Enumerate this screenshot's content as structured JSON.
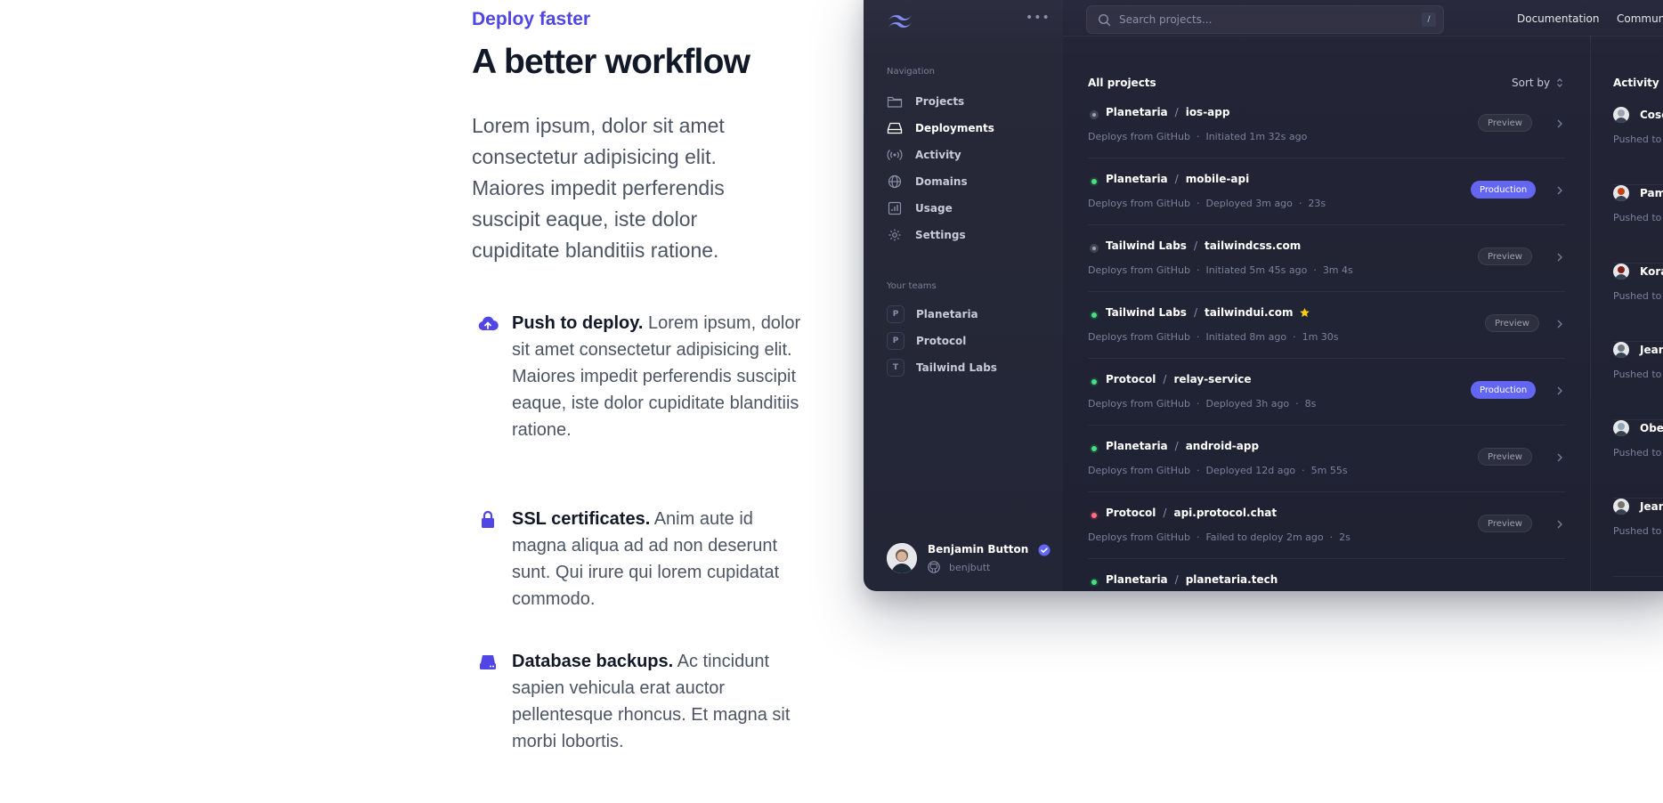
{
  "marketing": {
    "eyebrow": "Deploy faster",
    "headline": "A better workflow",
    "lead": "Lorem ipsum, dolor sit amet consectetur adipisicing elit. Maiores impedit perferendis suscipit eaque, iste dolor cupiditate blanditiis ratione.",
    "features": [
      {
        "title": "Push to deploy.",
        "text": " Lorem ipsum, dolor sit amet consectetur adipisicing elit. Maiores impedit perferendis suscipit eaque, iste dolor cupiditate blanditiis ratione.",
        "icon": "cloud-upload-icon"
      },
      {
        "title": "SSL certificates.",
        "text": " Anim aute id magna aliqua ad ad non deserunt sunt. Qui irure qui lorem cupidatat commodo.",
        "icon": "lock-icon"
      },
      {
        "title": "Database backups.",
        "text": " Ac tincidunt sapien vehicula erat auctor pellentesque rhoncus. Et magna sit morbi lobortis.",
        "icon": "server-icon"
      }
    ],
    "accent": "#4f46e5"
  },
  "app": {
    "search": {
      "placeholder": "Search projects...",
      "shortcut": "/"
    },
    "top_links": [
      "Documentation",
      "Community"
    ],
    "sidebar": {
      "nav_heading": "Navigation",
      "nav": [
        {
          "label": "Projects",
          "icon": "folder-icon"
        },
        {
          "label": "Deployments",
          "icon": "server-stack-icon"
        },
        {
          "label": "Activity",
          "icon": "signal-icon"
        },
        {
          "label": "Domains",
          "icon": "globe-icon"
        },
        {
          "label": "Usage",
          "icon": "chart-bar-icon"
        },
        {
          "label": "Settings",
          "icon": "gear-icon"
        }
      ],
      "teams_heading": "Your teams",
      "teams": [
        {
          "initial": "P",
          "label": "Planetaria"
        },
        {
          "initial": "P",
          "label": "Protocol"
        },
        {
          "initial": "T",
          "label": "Tailwind Labs"
        }
      ],
      "user": {
        "name": "Benjamin Button",
        "handle": "benjbutt"
      }
    },
    "projects": {
      "title": "All projects",
      "sort_label": "Sort by",
      "rows": [
        {
          "team": "Planetaria",
          "project": "ios-app",
          "status": "gray",
          "source": "Deploys from GitHub",
          "info": "Initiated 1m 32s ago",
          "duration": "",
          "env": "Preview",
          "starred": false
        },
        {
          "team": "Planetaria",
          "project": "mobile-api",
          "status": "green",
          "source": "Deploys from GitHub",
          "info": "Deployed 3m ago",
          "duration": "23s",
          "env": "Production",
          "starred": false
        },
        {
          "team": "Tailwind Labs",
          "project": "tailwindcss.com",
          "status": "gray",
          "source": "Deploys from GitHub",
          "info": "Initiated 5m 45s ago",
          "duration": "3m 4s",
          "env": "Preview",
          "starred": false
        },
        {
          "team": "Tailwind Labs",
          "project": "tailwindui.com",
          "status": "green",
          "source": "Deploys from GitHub",
          "info": "Initiated 8m ago",
          "duration": "1m 30s",
          "env": "Preview",
          "starred": true
        },
        {
          "team": "Protocol",
          "project": "relay-service",
          "status": "green",
          "source": "Deploys from GitHub",
          "info": "Deployed 3h ago",
          "duration": "8s",
          "env": "Production",
          "starred": false
        },
        {
          "team": "Planetaria",
          "project": "android-app",
          "status": "green",
          "source": "Deploys from GitHub",
          "info": "Deployed 12d ago",
          "duration": "5m 55s",
          "env": "Preview",
          "starred": false
        },
        {
          "team": "Protocol",
          "project": "api.protocol.chat",
          "status": "red",
          "source": "Deploys from GitHub",
          "info": "Failed to deploy 2m ago",
          "duration": "2s",
          "env": "Preview",
          "starred": false
        },
        {
          "team": "Planetaria",
          "project": "planetaria.tech",
          "status": "green",
          "source": "",
          "info": "",
          "duration": "",
          "env": "",
          "starred": false
        }
      ]
    },
    "activity": {
      "title": "Activity feed",
      "items": [
        {
          "name": "Cosette",
          "text": "Pushed to"
        },
        {
          "name": "Pamela",
          "text": "Pushed to"
        },
        {
          "name": "Kora",
          "text": "Pushed to"
        },
        {
          "name": "Jean",
          "text": "Pushed to"
        },
        {
          "name": "Oberon",
          "text": "Pushed to"
        },
        {
          "name": "Jean",
          "text": "Pushed to"
        }
      ]
    }
  }
}
